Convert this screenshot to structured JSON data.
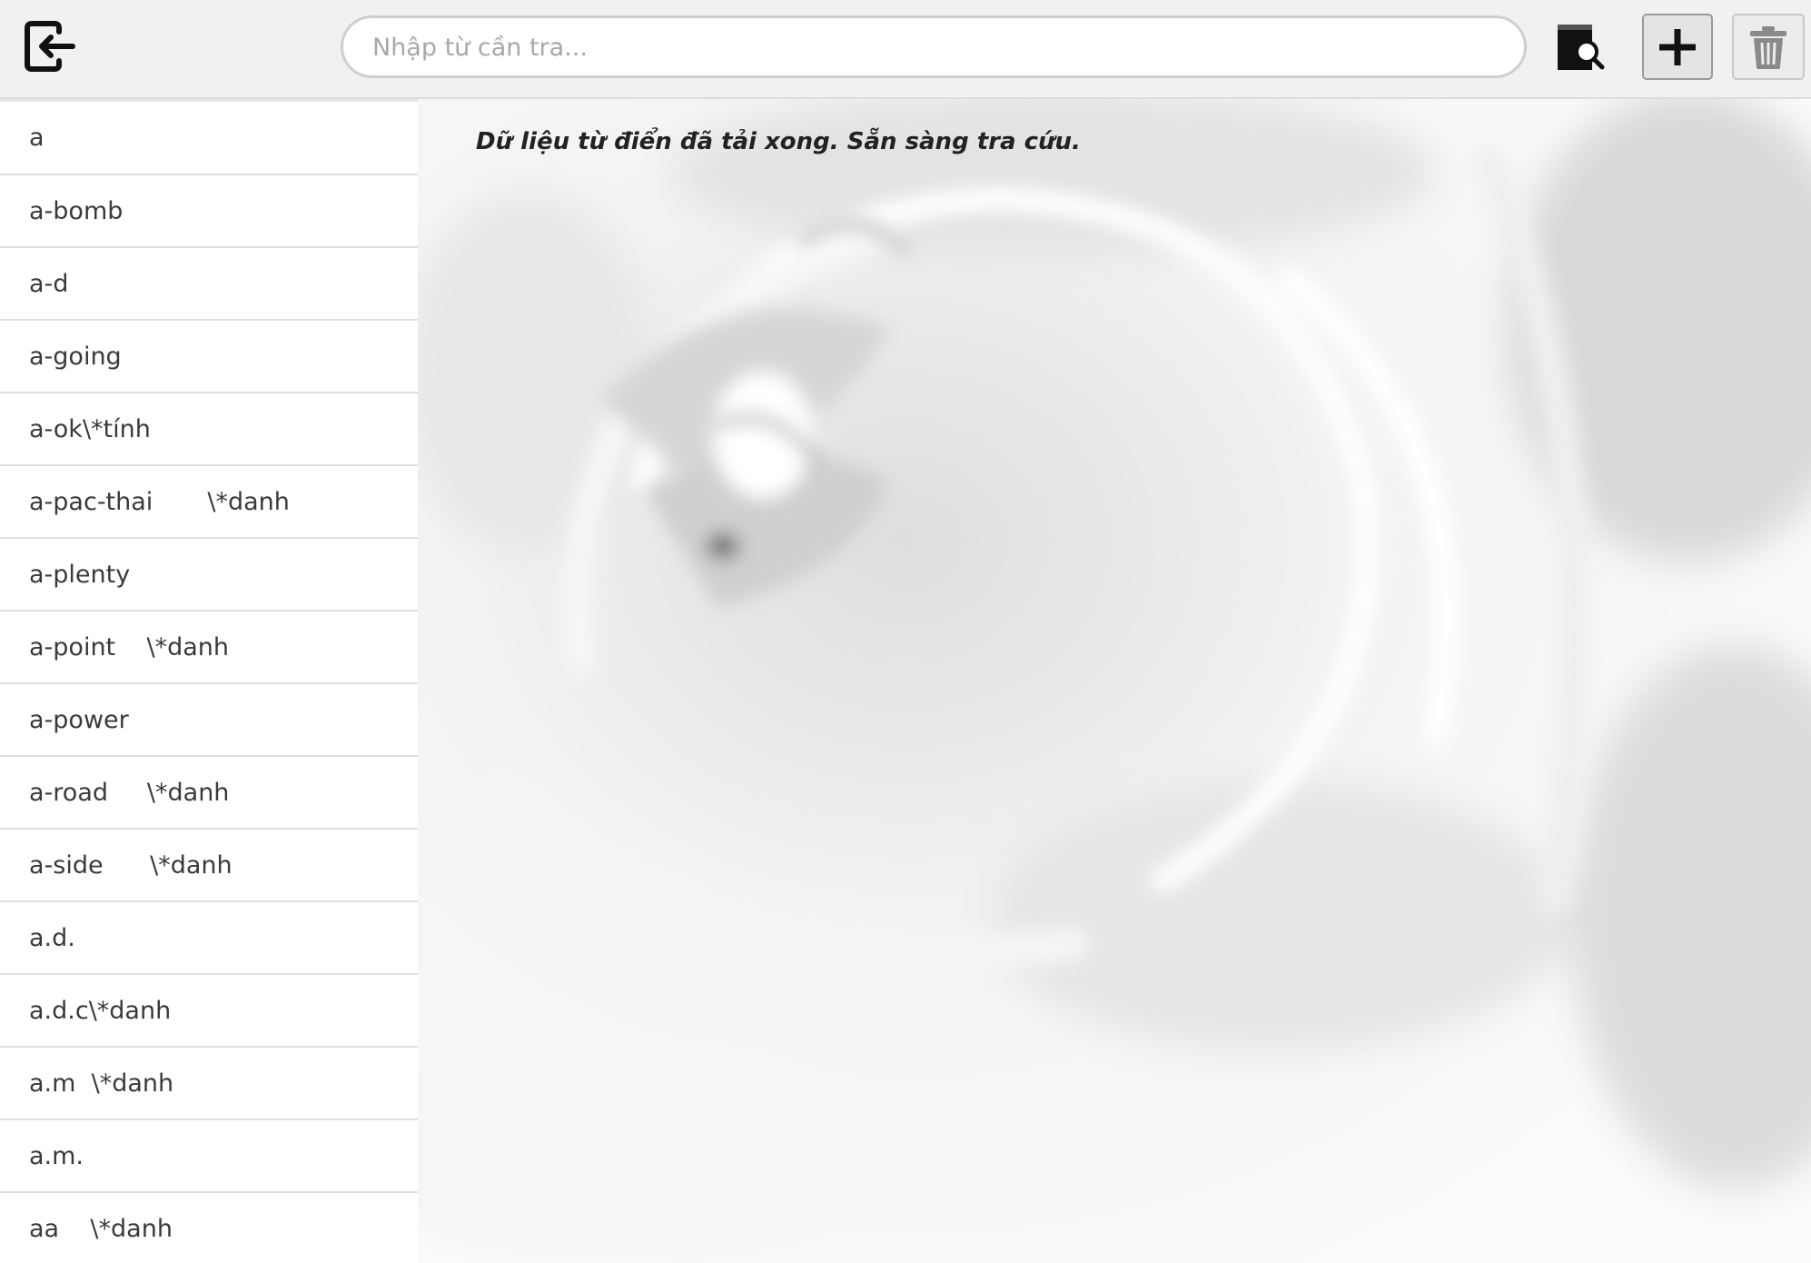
{
  "toolbar": {
    "logout_icon": "logout-icon",
    "search": {
      "placeholder": "Nhập từ cần tra...",
      "value": ""
    },
    "lookup_icon": "dictionary-search-icon",
    "add_icon": "plus-icon",
    "delete_icon": "trash-icon"
  },
  "word_list": {
    "items": [
      {
        "word": "a"
      },
      {
        "word": "a-bomb"
      },
      {
        "word": "a-d"
      },
      {
        "word": "a-going"
      },
      {
        "word": "a-ok\\*tính"
      },
      {
        "word": "a-pac-thai       \\*danh"
      },
      {
        "word": "a-plenty"
      },
      {
        "word": "a-point    \\*danh"
      },
      {
        "word": "a-power"
      },
      {
        "word": "a-road     \\*danh"
      },
      {
        "word": "a-side      \\*danh"
      },
      {
        "word": "a.d."
      },
      {
        "word": "a.d.c\\*danh"
      },
      {
        "word": "a.m  \\*danh"
      },
      {
        "word": "a.m."
      },
      {
        "word": "aa    \\*danh"
      }
    ]
  },
  "main": {
    "status": "Dữ liệu từ điển đã tải xong. Sẵn sàng tra cứu."
  },
  "colors": {
    "toolbar_bg": "#f1f1f1",
    "icon": "#111111",
    "text": "#3a3a3a"
  }
}
